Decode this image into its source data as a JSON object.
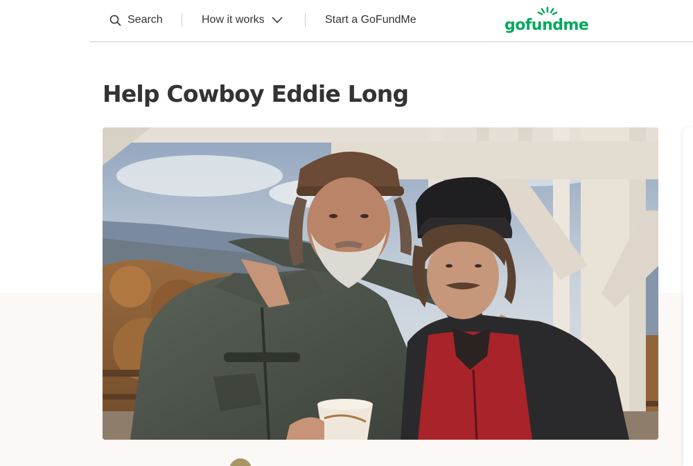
{
  "header": {
    "search_label": "Search",
    "how_it_works_label": "How it works",
    "start_label": "Start a GoFundMe",
    "logo_text": "gofundme",
    "brand_color": "#02a95c",
    "icons": {
      "search": "search-icon",
      "dropdown": "chevron-down-icon"
    }
  },
  "campaign": {
    "title": "Help Cowboy Eddie Long"
  }
}
